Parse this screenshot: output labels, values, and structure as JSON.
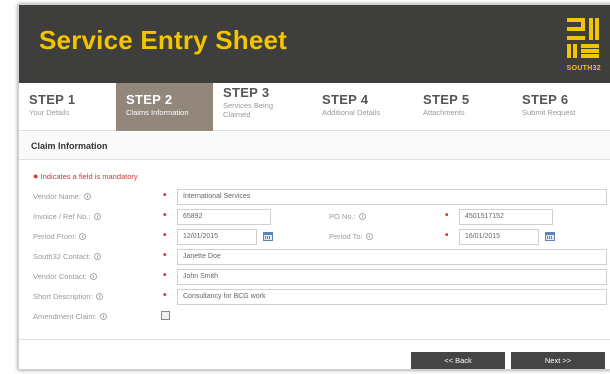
{
  "header": {
    "title": "Service Entry Sheet",
    "logo_text": "SOUTH32",
    "colors": {
      "background": "#3e3e3c",
      "title": "#f2c500",
      "active_step": "#93867b",
      "mandatory": "#d83232"
    }
  },
  "steps": [
    {
      "num": "STEP 1",
      "desc": "Your Details",
      "active": false
    },
    {
      "num": "STEP 2",
      "desc": "Claims Information",
      "active": true
    },
    {
      "num": "STEP 3",
      "desc": "Services Being Claimed",
      "active": false
    },
    {
      "num": "STEP 4",
      "desc": "Additional Details",
      "active": false
    },
    {
      "num": "STEP 5",
      "desc": "Attachments",
      "active": false
    },
    {
      "num": "STEP 6",
      "desc": "Submit Request",
      "active": false
    }
  ],
  "section": {
    "title": "Claim Information",
    "mandatory_note": "Indicates a field is mandatory"
  },
  "form": {
    "vendor_name": {
      "label": "Vendor Name:",
      "value": "International Services"
    },
    "invoice_ref": {
      "label": "Invoice / Ref No.:",
      "value": "65892"
    },
    "po_no": {
      "label": "PO No.:",
      "value": "4501517152"
    },
    "period_from": {
      "label": "Period From:",
      "value": "12/01/2015"
    },
    "period_to": {
      "label": "Period To:",
      "value": "16/01/2015"
    },
    "south32_contact": {
      "label": "South32 Contact:",
      "value": "Janette Doe"
    },
    "vendor_contact": {
      "label": "Vendor Contact:",
      "value": "John Smith"
    },
    "short_description": {
      "label": "Short Description:",
      "value": "Consultancy for BCG work"
    },
    "amendment_claim": {
      "label": "Amendment Claim:",
      "checked": false
    }
  },
  "footer": {
    "back_label": "<< Back",
    "next_label": "Next >>"
  }
}
